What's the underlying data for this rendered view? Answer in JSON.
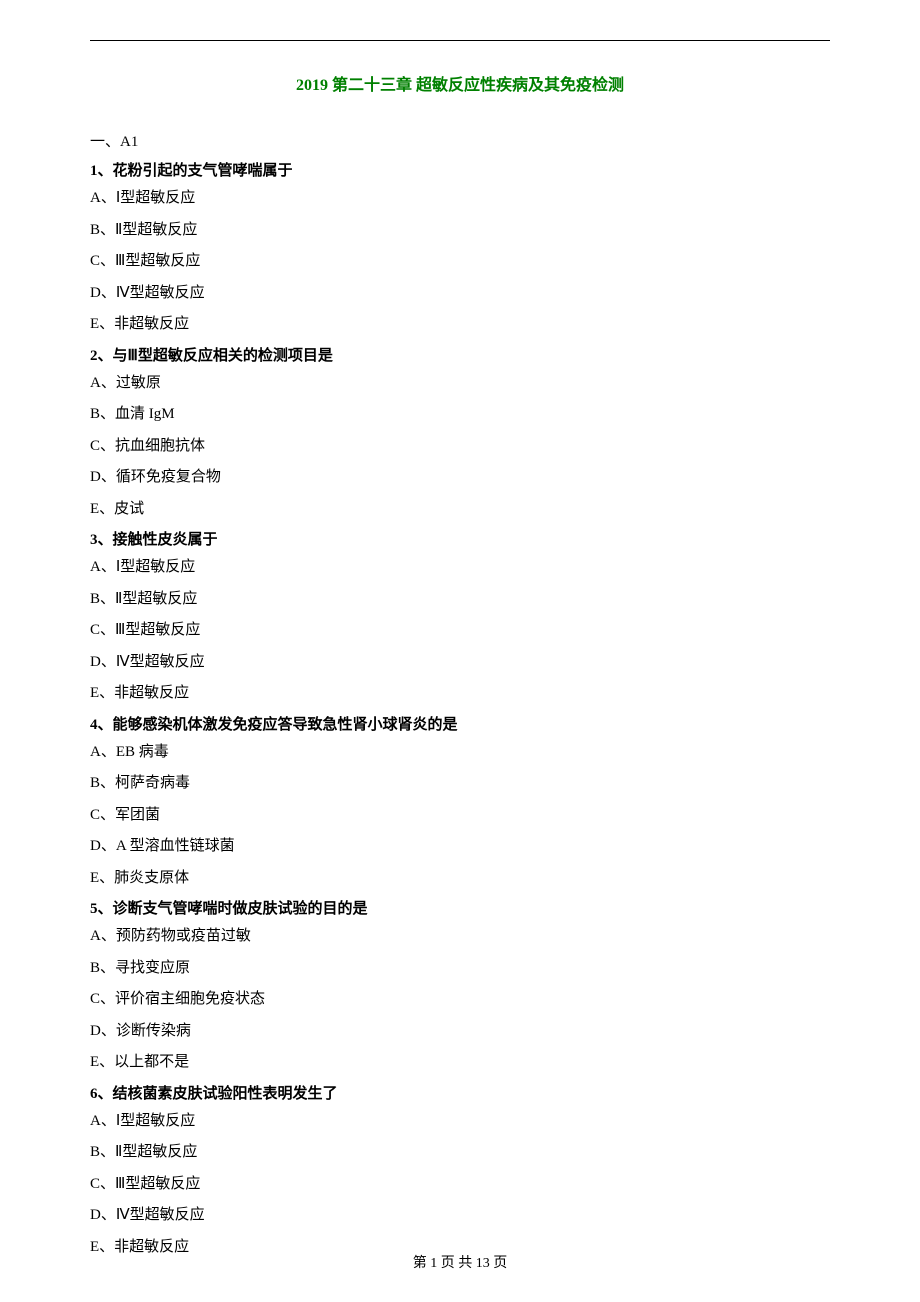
{
  "title": "2019 第二十三章 超敏反应性疾病及其免疫检测",
  "section_header": "一、A1",
  "questions": [
    {
      "number": "1、",
      "text": "花粉引起的支气管哮喘属于",
      "options": [
        "A、Ⅰ型超敏反应",
        "B、Ⅱ型超敏反应",
        "C、Ⅲ型超敏反应",
        "D、Ⅳ型超敏反应",
        "E、非超敏反应"
      ]
    },
    {
      "number": "2、",
      "text": "与Ⅲ型超敏反应相关的检测项目是",
      "options": [
        "A、过敏原",
        "B、血清 IgM",
        "C、抗血细胞抗体",
        "D、循环免疫复合物",
        "E、皮试"
      ]
    },
    {
      "number": "3、",
      "text": "接触性皮炎属于",
      "options": [
        "A、Ⅰ型超敏反应",
        "B、Ⅱ型超敏反应",
        "C、Ⅲ型超敏反应",
        "D、Ⅳ型超敏反应",
        "E、非超敏反应"
      ]
    },
    {
      "number": "4、",
      "text": "能够感染机体激发免疫应答导致急性肾小球肾炎的是",
      "options": [
        "A、EB 病毒",
        "B、柯萨奇病毒",
        "C、军团菌",
        "D、A 型溶血性链球菌",
        "E、肺炎支原体"
      ]
    },
    {
      "number": "5、",
      "text": "诊断支气管哮喘时做皮肤试验的目的是",
      "options": [
        "A、预防药物或疫苗过敏",
        "B、寻找变应原",
        "C、评价宿主细胞免疫状态",
        "D、诊断传染病",
        "E、以上都不是"
      ]
    },
    {
      "number": "6、",
      "text": "结核菌素皮肤试验阳性表明发生了",
      "options": [
        "A、Ⅰ型超敏反应",
        "B、Ⅱ型超敏反应",
        "C、Ⅲ型超敏反应",
        "D、Ⅳ型超敏反应",
        "E、非超敏反应"
      ]
    }
  ],
  "footer": "第 1 页 共 13 页"
}
